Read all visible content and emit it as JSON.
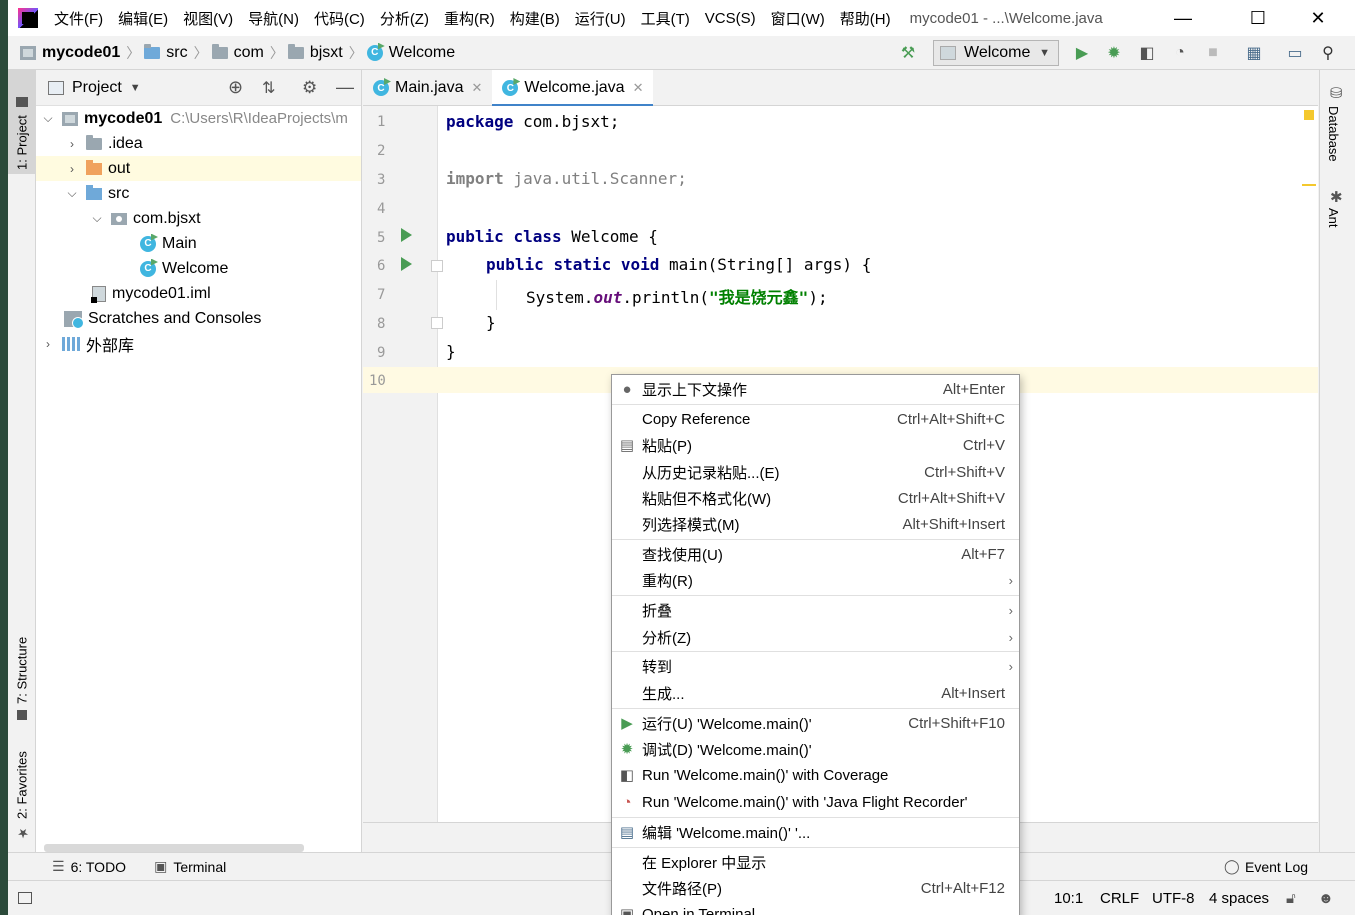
{
  "menu": {
    "items": [
      "文件(F)",
      "编辑(E)",
      "视图(V)",
      "导航(N)",
      "代码(C)",
      "分析(Z)",
      "重构(R)",
      "构建(B)",
      "运行(U)",
      "工具(T)",
      "VCS(S)",
      "窗口(W)",
      "帮助(H)"
    ],
    "title": "mycode01 - ...\\Welcome.java"
  },
  "nav": {
    "crumbs": [
      "mycode01",
      "src",
      "com",
      "bjsxt",
      "Welcome"
    ],
    "run_config": "Welcome"
  },
  "left_strip": {
    "project": "1: Project",
    "structure": "7: Structure",
    "favorites": "2: Favorites"
  },
  "project_panel": {
    "title": "Project",
    "tree": [
      {
        "label": "mycode01",
        "path": "C:\\Users\\R\\IdeaProjects\\m"
      },
      {
        "label": ".idea"
      },
      {
        "label": "out"
      },
      {
        "label": "src"
      },
      {
        "label": "com.bjsxt"
      },
      {
        "label": "Main"
      },
      {
        "label": "Welcome"
      },
      {
        "label": "mycode01.iml"
      },
      {
        "label": "Scratches and Consoles"
      },
      {
        "label": "外部库"
      }
    ]
  },
  "editor": {
    "tabs": [
      "Main.java",
      "Welcome.java"
    ],
    "line_numbers": [
      "1",
      "2",
      "3",
      "4",
      "5",
      "6",
      "7",
      "8",
      "9",
      "10"
    ],
    "code": {
      "l1_kw": "package",
      "l1_rest": " com.bjsxt;",
      "l3_kw": "import",
      "l3_rest": " java.util.Scanner;",
      "l5_kw1": "public",
      "l5_kw2": "class",
      "l5_rest": " Welcome {",
      "l6_kw1": "public",
      "l6_kw2": "static",
      "l6_kw3": "void",
      "l6_rest": " main(String[] args) {",
      "l7_a": "System.",
      "l7_field": "out",
      "l7_b": ".println(",
      "l7_str": "\"我是饶元鑫\"",
      "l7_c": ");",
      "l8": "}",
      "l9": "}"
    }
  },
  "right_strip": {
    "database": "Database",
    "ant": "Ant"
  },
  "context_menu": {
    "items": [
      {
        "label": "显示上下文操作",
        "shortcut": "Alt+Enter"
      },
      {
        "label": "Copy Reference",
        "shortcut": "Ctrl+Alt+Shift+C"
      },
      {
        "label": "粘贴(P)",
        "shortcut": "Ctrl+V"
      },
      {
        "label": "从历史记录粘贴...(E)",
        "shortcut": "Ctrl+Shift+V"
      },
      {
        "label": "粘贴但不格式化(W)",
        "shortcut": "Ctrl+Alt+Shift+V"
      },
      {
        "label": "列选择模式(M)",
        "shortcut": "Alt+Shift+Insert"
      },
      {
        "label": "查找使用(U)",
        "shortcut": "Alt+F7"
      },
      {
        "label": "重构(R)",
        "shortcut": ""
      },
      {
        "label": "折叠",
        "shortcut": ""
      },
      {
        "label": "分析(Z)",
        "shortcut": ""
      },
      {
        "label": "转到",
        "shortcut": ""
      },
      {
        "label": "生成...",
        "shortcut": "Alt+Insert"
      },
      {
        "label": "运行(U) 'Welcome.main()'",
        "shortcut": "Ctrl+Shift+F10"
      },
      {
        "label": "调试(D) 'Welcome.main()'",
        "shortcut": ""
      },
      {
        "label": "Run 'Welcome.main()' with Coverage",
        "shortcut": ""
      },
      {
        "label": "Run 'Welcome.main()' with 'Java Flight Recorder'",
        "shortcut": ""
      },
      {
        "label": "编辑 'Welcome.main()' '...",
        "shortcut": ""
      },
      {
        "label": "在 Explorer 中显示",
        "shortcut": ""
      },
      {
        "label": "文件路径(P)",
        "shortcut": "Ctrl+Alt+F12"
      },
      {
        "label": "Open in Terminal",
        "shortcut": ""
      }
    ]
  },
  "bottom_tools": {
    "todo": "6: TODO",
    "terminal": "Terminal",
    "event_log": "Event Log"
  },
  "status": {
    "position": "10:1",
    "line_sep": "CRLF",
    "encoding": "UTF-8",
    "indent": "4 spaces"
  },
  "colors": {
    "accent": "#4083c9",
    "run_green": "#499c54",
    "keyword": "#000080",
    "string": "#008000"
  }
}
